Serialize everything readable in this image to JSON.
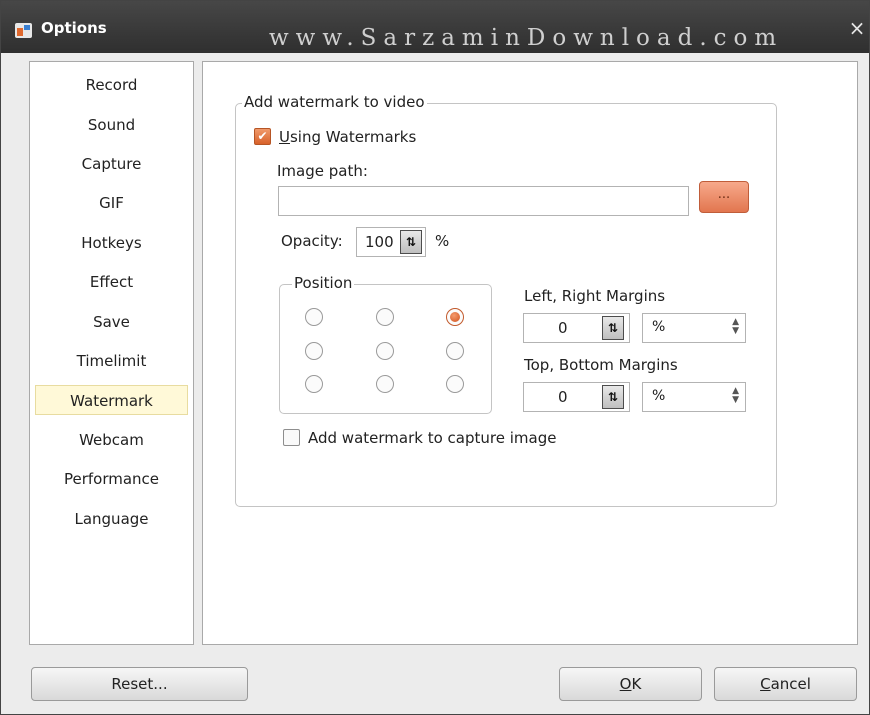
{
  "window": {
    "title": "Options",
    "watermark_overlay": "www.SarzaminDownload.com",
    "close_glyph": "×"
  },
  "sidebar": {
    "items": [
      {
        "label": "Record"
      },
      {
        "label": "Sound"
      },
      {
        "label": "Capture"
      },
      {
        "label": "GIF"
      },
      {
        "label": "Hotkeys"
      },
      {
        "label": "Effect"
      },
      {
        "label": "Save"
      },
      {
        "label": "Timelimit"
      },
      {
        "label": "Watermark",
        "selected": true
      },
      {
        "label": "Webcam"
      },
      {
        "label": "Performance"
      },
      {
        "label": "Language"
      }
    ]
  },
  "watermark": {
    "group_title": "Add watermark to video",
    "using_watermarks": {
      "mnemonic": "U",
      "rest": "sing Watermarks",
      "checked": true
    },
    "image_path_label": "Image path:",
    "image_path_value": "",
    "browse_label": "...",
    "opacity_label": "Opacity:",
    "opacity_value": "100",
    "opacity_unit": "%",
    "position": {
      "title": "Position",
      "selected": "top-right"
    },
    "lr_margins": {
      "label": "Left, Right Margins",
      "value": "0",
      "unit": "%"
    },
    "tb_margins": {
      "label": "Top, Bottom Margins",
      "value": "0",
      "unit": "%"
    },
    "capture_image": {
      "label": "Add watermark to capture image",
      "checked": false
    }
  },
  "footer": {
    "reset_label": "Reset...",
    "ok": {
      "mnemonic": "O",
      "rest": "K"
    },
    "cancel": {
      "mnemonic": "C",
      "rest": "ancel"
    }
  },
  "icons": {
    "spin": "⇅",
    "check": "✔",
    "up_arrow": "▲",
    "down_arrow": "▼"
  },
  "colors": {
    "accent": "#e2764f",
    "titlebar": "#3a3a3a",
    "selection_bg": "#fff9d8"
  }
}
